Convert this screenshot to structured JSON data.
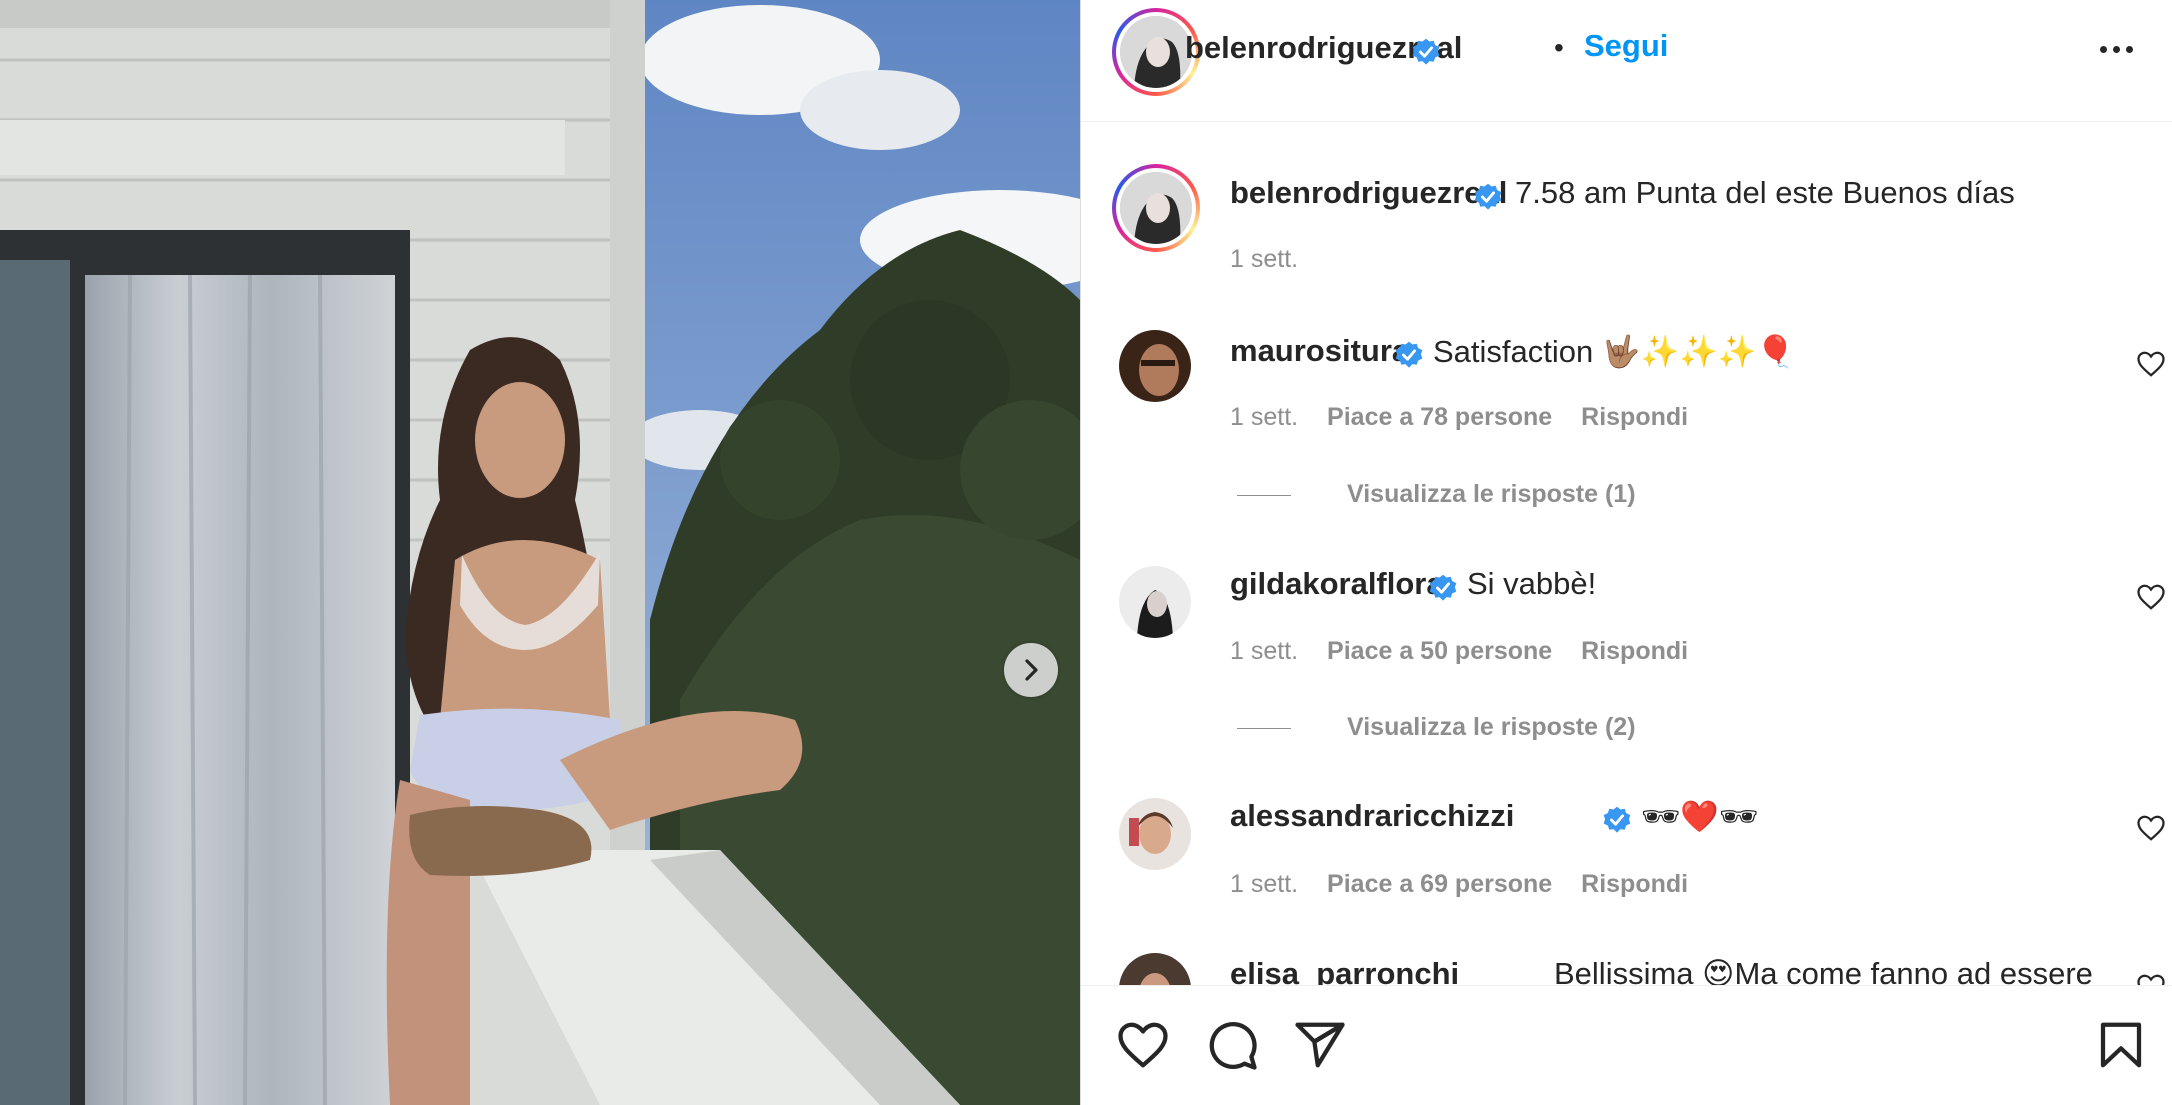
{
  "post": {
    "author": "belenrodriguezreal",
    "follow_label": "Segui",
    "separator": "•",
    "caption": "7.58 am Punta del este Buenos días",
    "caption_time": "1 sett."
  },
  "comments": [
    {
      "user": "maurositura",
      "verified": true,
      "text": "Satisfaction 🤟🏽✨✨✨🎈",
      "time": "1 sett.",
      "likes": "Piace a 78 persone",
      "reply": "Rispondi",
      "view_replies": "Visualizza le risposte (1)"
    },
    {
      "user": "gildakoralflora",
      "verified": true,
      "text": "Si vabbè!",
      "time": "1 sett.",
      "likes": "Piace a 50 persone",
      "reply": "Rispondi",
      "view_replies": "Visualizza le risposte (2)"
    },
    {
      "user": "alessandraricchizzi",
      "verified": true,
      "text": "🕶❤️🕶",
      "time": "1 sett.",
      "likes": "Piace a 69 persone",
      "reply": "Rispondi"
    },
    {
      "user": "elisa_parronchi",
      "verified": false,
      "text": "Bellissima 😍Ma come fanno ad essere"
    }
  ],
  "icons": {
    "next": "chevron-right-icon",
    "more": "more-options-icon",
    "verified": "verified-badge-icon",
    "like": "heart-icon",
    "comment": "comment-icon",
    "share": "share-icon",
    "save": "bookmark-icon"
  },
  "colors": {
    "link_blue": "#0095f6",
    "verified_blue": "#3897f0",
    "muted_text": "#8e8e8e",
    "text": "#262626"
  }
}
